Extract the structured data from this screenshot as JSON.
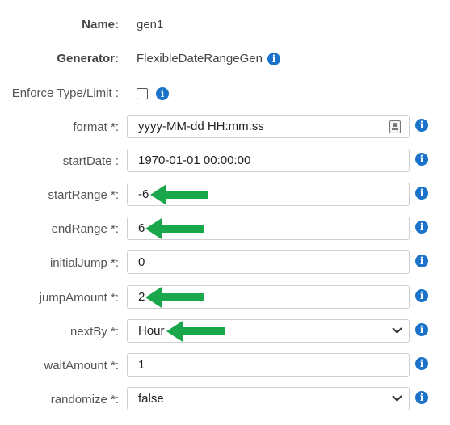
{
  "header": {
    "name_label": "Name:",
    "name_value": "gen1",
    "generator_label": "Generator:",
    "generator_value": "FlexibleDateRangeGen",
    "enforce_label": "Enforce Type/Limit :",
    "enforce_checked": false
  },
  "fields": {
    "format": {
      "label": "format *:",
      "value": "yyyy-MM-dd HH:mm:ss"
    },
    "startDate": {
      "label": "startDate :",
      "value": "1970-01-01 00:00:00"
    },
    "startRange": {
      "label": "startRange *:",
      "value": "-6"
    },
    "endRange": {
      "label": "endRange *:",
      "value": "6"
    },
    "initialJump": {
      "label": "initialJump *:",
      "value": "0"
    },
    "jumpAmount": {
      "label": "jumpAmount *:",
      "value": "2"
    },
    "nextBy": {
      "label": "nextBy *:",
      "value": "Hour"
    },
    "waitAmount": {
      "label": "waitAmount *:",
      "value": "1"
    },
    "randomize": {
      "label": "randomize *:",
      "value": "false"
    }
  },
  "icons": {
    "info": "info-icon",
    "contact": "contact-card-icon",
    "dropdown": "chevron-down-icon",
    "arrow": "green-arrow-annotation"
  },
  "colors": {
    "info_blue": "#1a73c8",
    "arrow_green": "#1aa64a"
  }
}
